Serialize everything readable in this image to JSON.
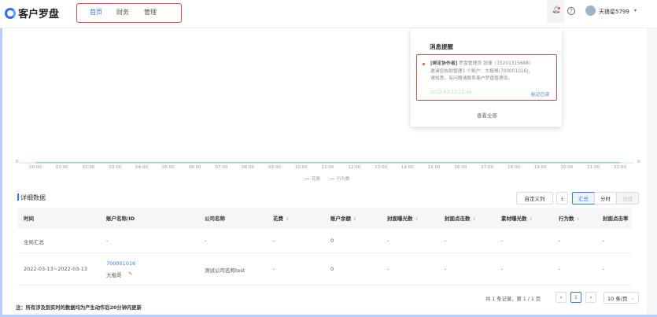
{
  "header": {
    "logo_text": "客户罗盘",
    "nav": [
      "首页",
      "财务",
      "管理"
    ],
    "active_nav": 0,
    "username": "天狼星5799"
  },
  "notification": {
    "title": "消息提醒",
    "tag": "[绑定协作者]",
    "line1": "罗盘管理员 张珊（15201315688）",
    "line2": "邀请您协助管理1 个账户：大楷哥(700001016)，",
    "line3": "请知悉，有问题请联系客户罗盘管理员。",
    "time": "2022-03-13 22:48",
    "mark_read": "标记已读",
    "view_all": "查看全部"
  },
  "chart_data": {
    "type": "line",
    "x": [
      "00:00",
      "01:00",
      "02:00",
      "03:00",
      "04:00",
      "05:00",
      "06:00",
      "07:00",
      "08:00",
      "09:00",
      "10:00",
      "11:00",
      "12:00",
      "13:00",
      "14:00",
      "15:00",
      "16:00",
      "17:00",
      "18:00",
      "19:00",
      "20:00",
      "21:00",
      "22:00"
    ],
    "series": [
      {
        "name": "花费",
        "values": [
          0,
          0,
          0,
          0,
          0,
          0,
          0,
          0,
          0,
          0,
          0,
          0,
          0,
          0,
          0,
          0,
          0,
          0,
          0,
          0,
          0,
          0,
          0
        ],
        "color": "#8fb4f7"
      },
      {
        "name": "行为数",
        "values": [
          0,
          0,
          0,
          0,
          0,
          0,
          0,
          0,
          0,
          0,
          0,
          0,
          0,
          0,
          0,
          0,
          0,
          0,
          0,
          0,
          0,
          0,
          0
        ],
        "color": "#7fdcb0"
      }
    ],
    "y_left_label": "0",
    "y_right_label": "0",
    "legend": "bottom-center"
  },
  "section": {
    "title": "详细数据",
    "custom_cols": "自定义列",
    "views": [
      "汇总",
      "分时",
      "分日"
    ]
  },
  "table": {
    "headers": [
      "时间",
      "账户名称/ID",
      "公司名称",
      "花费",
      "账户余额",
      "封面曝光数",
      "封面点击数",
      "素材曝光数",
      "行为数",
      "封面点击率"
    ],
    "rows": [
      [
        "全局汇总",
        "-",
        "-",
        "-",
        "0",
        "-",
        "-",
        "-",
        "-",
        "-"
      ],
      [
        "2022-03-13~2022-03-13",
        "700001016",
        "测试公司名称test",
        "-",
        "0",
        "-",
        "-",
        "-",
        "-",
        "-"
      ]
    ],
    "row2_account_name": "大楷哥"
  },
  "pagination": {
    "summary": "共 1 条记录，第 1 / 1 页",
    "current": "1",
    "page_size": "10 条/页"
  },
  "note": "注：所有涉及到实时的数据均为产生动作后20分钟内更新"
}
